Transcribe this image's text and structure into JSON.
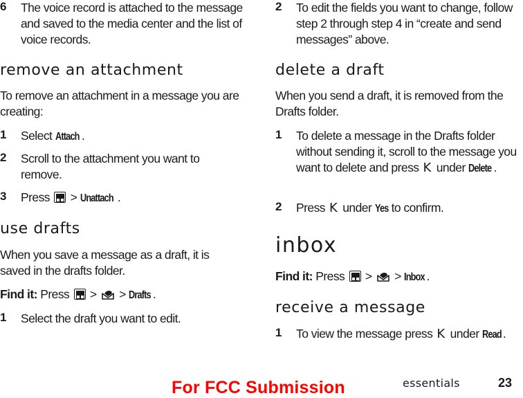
{
  "left": {
    "step6": {
      "num": "6",
      "text": "The voice record is attached to the message and saved to the media center and the list of voice records."
    },
    "remove": {
      "heading": "remove an attachment",
      "intro": "To remove an attachment in a message you are creating:",
      "steps": [
        {
          "num": "1",
          "pre": "Select ",
          "kw": "Attach",
          "post": "."
        },
        {
          "num": "2",
          "text": "Scroll to the attachment you want to remove."
        },
        {
          "num": "3",
          "pre": "Press",
          "sep": ">",
          "kw": "Unattach",
          "post": "."
        }
      ]
    },
    "drafts": {
      "heading": "use drafts",
      "intro": "When you save a message as a draft, it is saved in the drafts folder.",
      "findit_label": "Find it:",
      "findit_press": "Press",
      "sep": ">",
      "findit_kw": "Drafts",
      "post": ".",
      "steps": [
        {
          "num": "1",
          "text": "Select the draft you want to edit."
        }
      ]
    }
  },
  "right": {
    "step2": {
      "num": "2",
      "text": "To edit the fields you want to change, follow step 2 through step 4 in “create and send messages” above."
    },
    "delete": {
      "heading": "delete a draft",
      "intro": "When you send a draft, it is removed from the Drafts folder.",
      "steps": [
        {
          "num": "1",
          "pre": "To delete a message in the Drafts folder without sending it, scroll to the message you want to delete and press",
          "softkey": "K",
          "mid": "under",
          "kw": "Delete",
          "post": "."
        },
        {
          "num": "2",
          "pre": "Press",
          "softkey": "K",
          "mid": "under",
          "kw": "Yes",
          "post": "to confirm."
        }
      ]
    },
    "inbox": {
      "heading": "inbox",
      "findit_label": "Find it:",
      "findit_press": "Press",
      "sep": ">",
      "findit_kw": "Inbox",
      "post": "."
    },
    "receive": {
      "heading": "receive a message",
      "steps": [
        {
          "num": "1",
          "pre": "To view the message press",
          "softkey": "K",
          "mid": "under",
          "kw": "Read",
          "post": "."
        }
      ]
    }
  },
  "footer": {
    "section": "essentials",
    "page": "23",
    "watermark": "For FCC Submission",
    "watermark_color": "#ff0000"
  },
  "icons": {
    "menu_key": "menu-key-icon",
    "messages": "envelope-icon",
    "softkey": "left-softkey-icon"
  }
}
